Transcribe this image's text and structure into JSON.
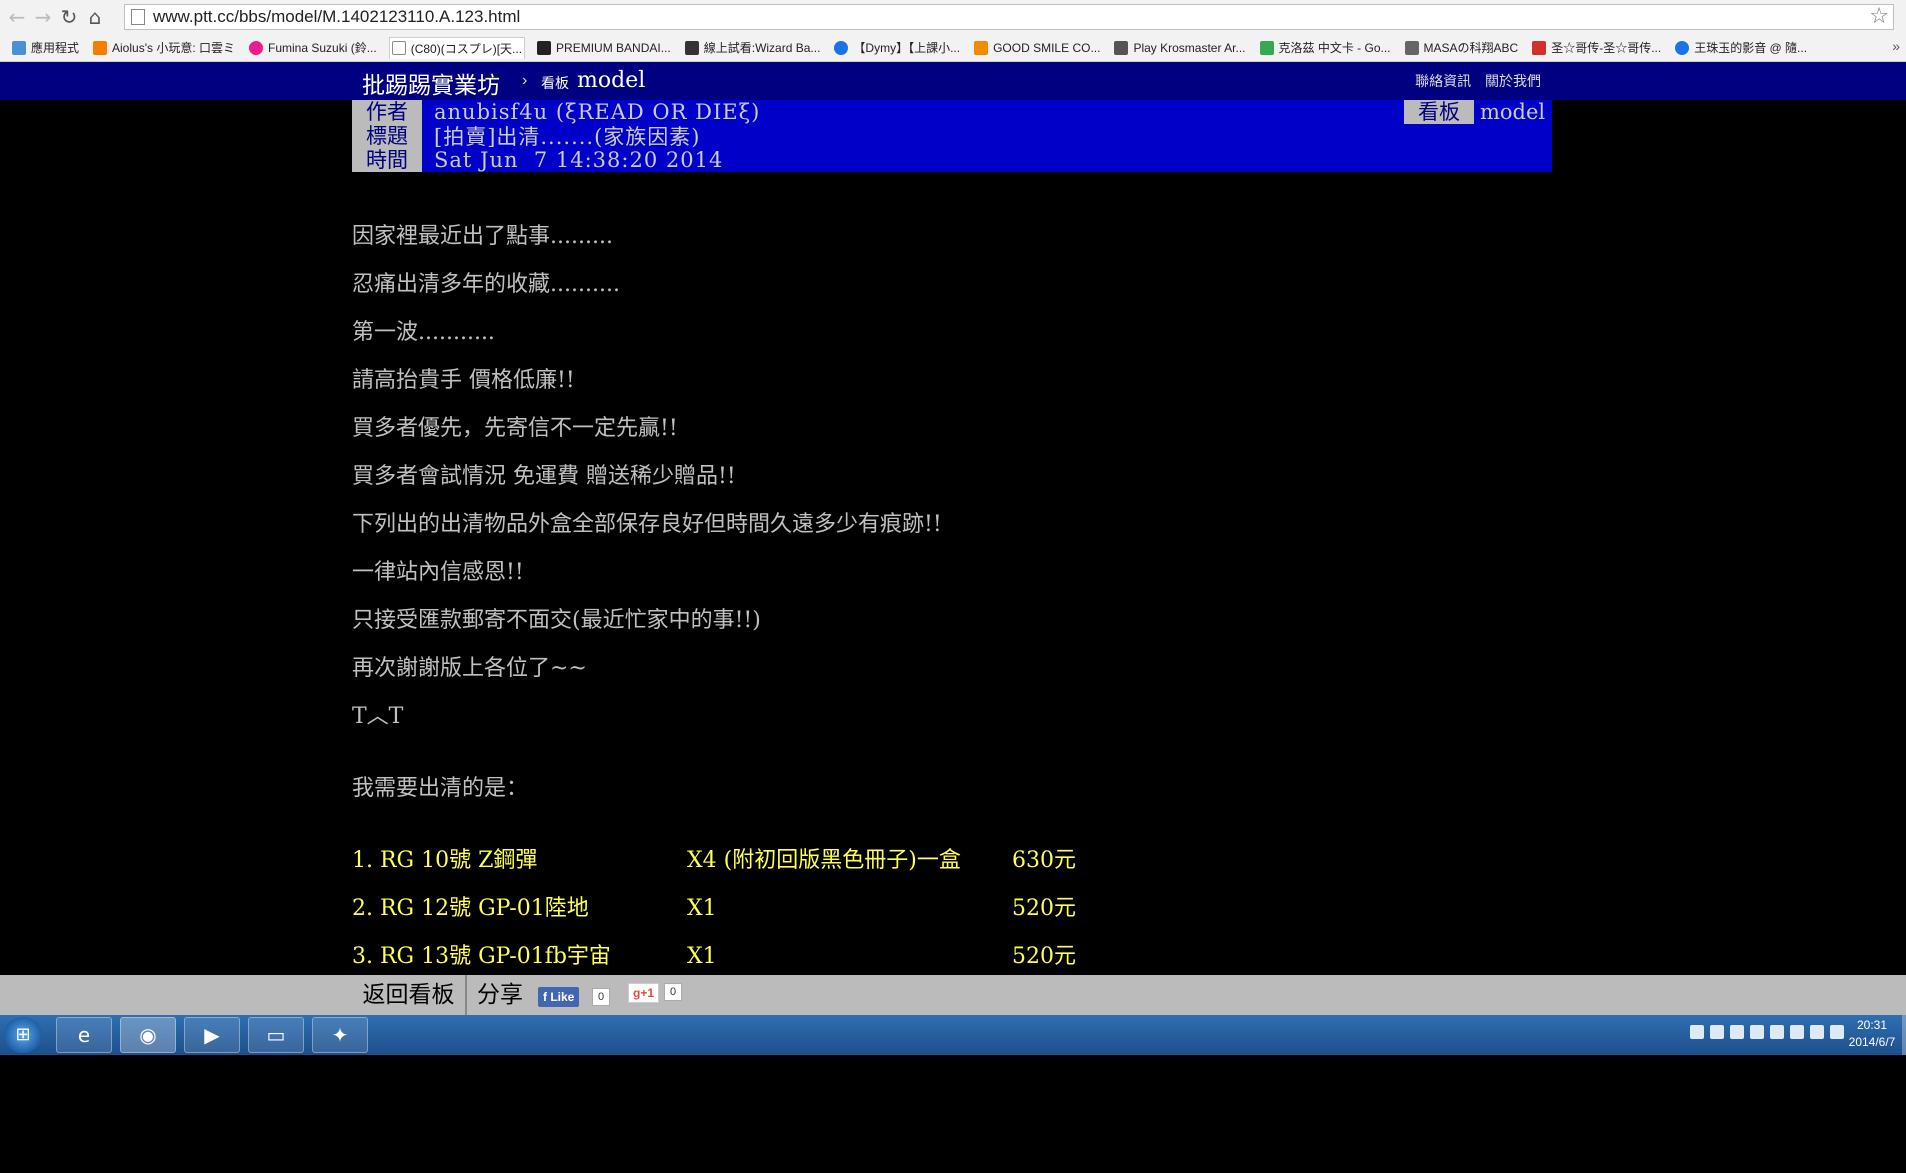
{
  "browser": {
    "url": "www.ptt.cc/bbs/model/M.1402123110.A.123.html",
    "bookmarks": [
      {
        "label": "應用程式",
        "color": "#4a90d9"
      },
      {
        "label": "Aiolus's 小玩意: 口雲ミ",
        "color": "#f57d00"
      },
      {
        "label": "Fumina Suzuki (鈴...",
        "color": "#e91e8c"
      },
      {
        "label": "(C80)(コスプレ)[天...",
        "color": "#ffffff",
        "active": true
      },
      {
        "label": "PREMIUM BANDAI...",
        "color": "#222222"
      },
      {
        "label": "線上試看:Wizard Ba...",
        "color": "#333333"
      },
      {
        "label": "【Dymy】【上課小...",
        "color": "#1a73e8"
      },
      {
        "label": "GOOD SMILE CO...",
        "color": "#f08c00"
      },
      {
        "label": "Play Krosmaster Ar...",
        "color": "#555555"
      },
      {
        "label": "克洛茲 中文卡 - Go...",
        "color": "#34a853"
      },
      {
        "label": "MASAの科翔ABC",
        "color": "#666666"
      },
      {
        "label": "圣☆哥传-圣☆哥传...",
        "color": "#d32f2f"
      },
      {
        "label": "王珠玉的影音 @ 隨...",
        "color": "#1a73e8"
      }
    ],
    "bookmark_overflow": "»"
  },
  "site": {
    "title": "批踢踢實業坊",
    "separator": "›",
    "board_label": "看板",
    "board_name": "model",
    "links": [
      "聯絡資訊",
      "關於我們"
    ]
  },
  "meta": {
    "author_tag": "作者",
    "author": "anubisf4u (ξREAD OR DIEξ)",
    "title_tag": "標題",
    "title": "[拍賣]出清.......(家族因素)",
    "time_tag": "時間",
    "time": "Sat Jun  7 14:38:20 2014",
    "board_tag": "看板",
    "board": "model"
  },
  "article": {
    "lines": [
      "因家裡最近出了點事.........",
      "忍痛出清多年的收藏..........",
      "第一波...........",
      "請高抬貴手 價格低廉!!",
      "買多者優先，先寄信不一定先贏!!",
      "買多者會試情況 免運費 贈送稀少贈品!!",
      "下列出的出清物品外盒全部保存良好但時間久遠多少有痕跡!!",
      "一律站內信感恩!!",
      "只接受匯款郵寄不面交(最近忙家中的事!!)",
      "再次謝謝版上各位了~~",
      "T︿T"
    ],
    "list_heading": "我需要出清的是：",
    "items": [
      {
        "name": "1. RG 10號 Z鋼彈",
        "qty": "X4 (附初回版黑色冊子)一盒",
        "price": "630元"
      },
      {
        "name": "2. RG 12號 GP-01陸地",
        "qty": "X1",
        "price": "520元"
      },
      {
        "name": "3. RG 13號 GP-01fb宇宙",
        "qty": "X1",
        "price": "520元"
      }
    ]
  },
  "bottom": {
    "back_label": "返回看板",
    "share_label": "分享",
    "fb_like": "Like",
    "fb_count": "0",
    "gplus": "g+1",
    "gplus_count": "0"
  },
  "taskbar": {
    "time": "20:31",
    "date": "2014/6/7"
  },
  "colors": {
    "site_bar": "#000080",
    "meta_bg": "#0000c8",
    "tag_bg": "#bbbbbb",
    "body_text": "#c0c0c0",
    "item_text": "#ffff55"
  }
}
